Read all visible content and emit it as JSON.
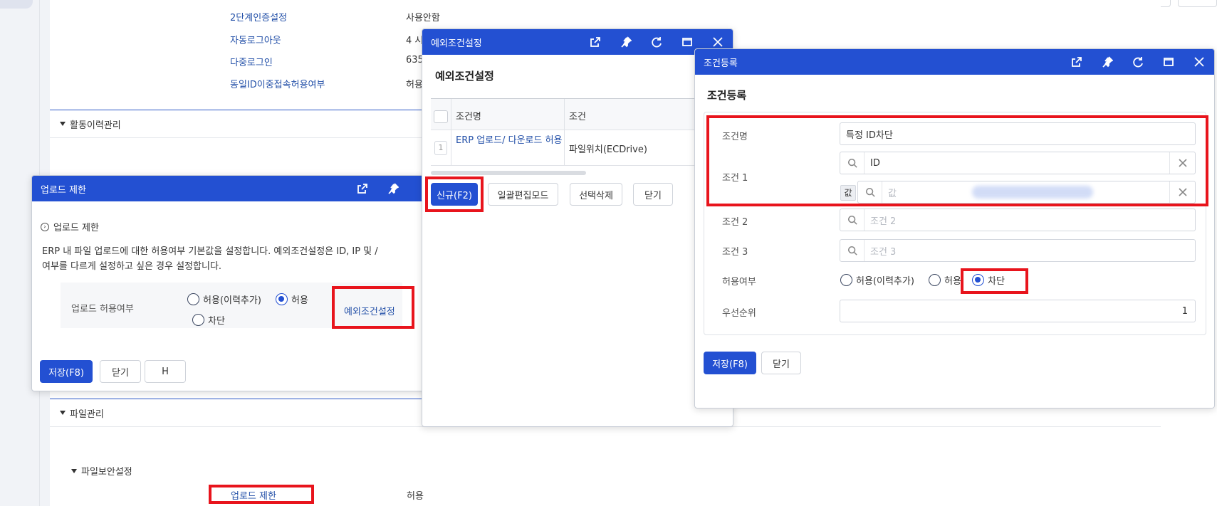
{
  "background": {
    "settings": [
      {
        "label": "2단계인증설정",
        "value": "사용안함"
      },
      {
        "label": "자동로그아웃",
        "value": "4 시"
      },
      {
        "label": "다중로그인",
        "value": "635"
      },
      {
        "label": "동일ID이중접속허용여부",
        "value": "허용"
      }
    ],
    "section_activity": "활동이력관리",
    "section_file": "파일관리",
    "subsection_file_security": "파일보안설정",
    "upload_row": {
      "label": "업로드 제한",
      "value": "허용"
    }
  },
  "upload_dialog": {
    "title": "업로드 제한",
    "heading": "업로드 제한",
    "description_line1": "ERP 내 파일 업로드에 대한 허용여부 기본값을 설정합니다. 예외조건설정은 ID, IP 및 /",
    "description_line2": "여부를 다르게 설정하고 싶은 경우 설정합니다.",
    "field_label": "업로드 허용여부",
    "options": [
      "허용(이력추가)",
      "허용",
      "차단"
    ],
    "selected_option": "허용",
    "exception_link": "예외조건설정",
    "save_label": "저장(F8)",
    "close_label": "닫기",
    "h_label": "H"
  },
  "exception_dialog": {
    "title": "예외조건설정",
    "heading": "예외조건설정",
    "columns": [
      "조건명",
      "조건"
    ],
    "rows": [
      {
        "no": "1",
        "name": "ERP 업로드/ 다운로드 허용",
        "condition": "파일위치(ECDrive)"
      }
    ],
    "new_label": "신규(F2)",
    "bulk_edit_label": "일괄편집모드",
    "delete_label": "선택삭제",
    "close_label": "닫기"
  },
  "condition_dialog": {
    "title": "조건등록",
    "heading": "조건등록",
    "name_label": "조건명",
    "name_value": "특정 ID차단",
    "cond1_label": "조건 1",
    "cond1_value": "ID",
    "cond1_sub_tag": "값",
    "cond1_sub_placeholder": "값",
    "cond2_label": "조건 2",
    "cond2_placeholder": "조건 2",
    "cond3_label": "조건 3",
    "cond3_placeholder": "조건 3",
    "allow_label": "허용여부",
    "allow_options": [
      "허용(이력추가)",
      "허용",
      "차단"
    ],
    "allow_selected": "차단",
    "priority_label": "우선순위",
    "priority_value": "1",
    "save_label": "저장(F8)",
    "close_label": "닫기"
  },
  "colors": {
    "primary": "#2350d2",
    "highlight": "#e8141c"
  }
}
